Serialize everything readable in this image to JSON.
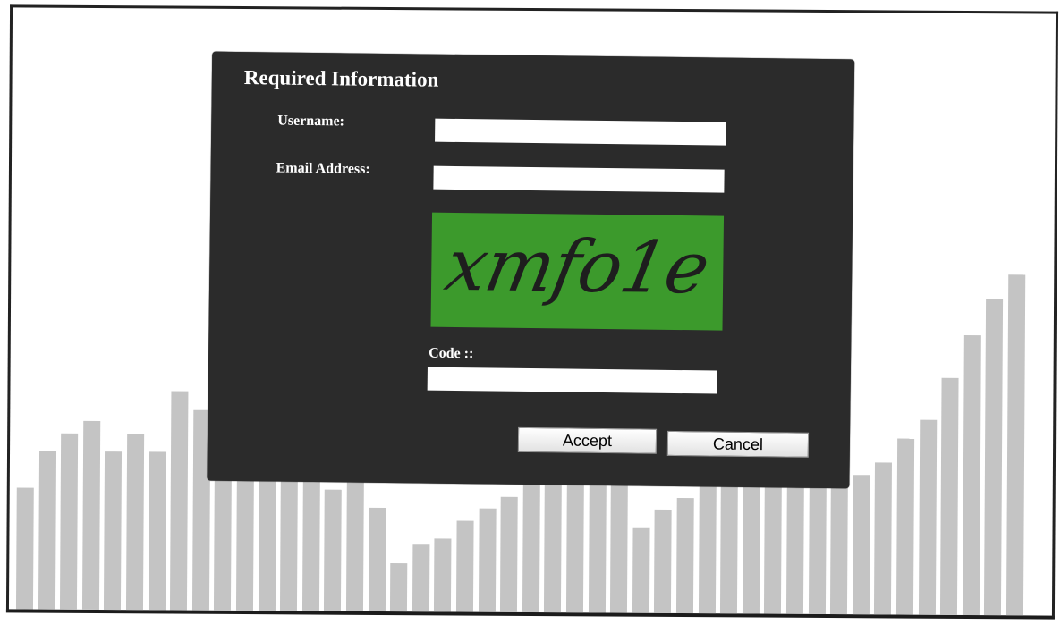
{
  "dialog": {
    "title": "Required Information",
    "fields": {
      "username": {
        "label": "Username:",
        "value": ""
      },
      "email": {
        "label": "Email Address:",
        "value": ""
      },
      "code": {
        "label": "Code ::",
        "value": ""
      }
    },
    "captcha": {
      "text": "xmfo1e",
      "background_color": "#3c9a2c"
    },
    "buttons": {
      "accept": "Accept",
      "cancel": "Cancel"
    }
  },
  "background_chart": {
    "bar_color": "#c4c4c4",
    "values": [
      0.2,
      0.26,
      0.29,
      0.31,
      0.26,
      0.29,
      0.26,
      0.36,
      0.33,
      0.3,
      0.28,
      0.27,
      0.26,
      0.25,
      0.2,
      0.22,
      0.17,
      0.08,
      0.11,
      0.12,
      0.15,
      0.17,
      0.19,
      0.22,
      0.25,
      0.28,
      0.31,
      0.34,
      0.14,
      0.17,
      0.19,
      0.23,
      0.26,
      0.3,
      0.33,
      0.37,
      0.39,
      0.29,
      0.23,
      0.25,
      0.29,
      0.32,
      0.39,
      0.46,
      0.52,
      0.56
    ]
  }
}
